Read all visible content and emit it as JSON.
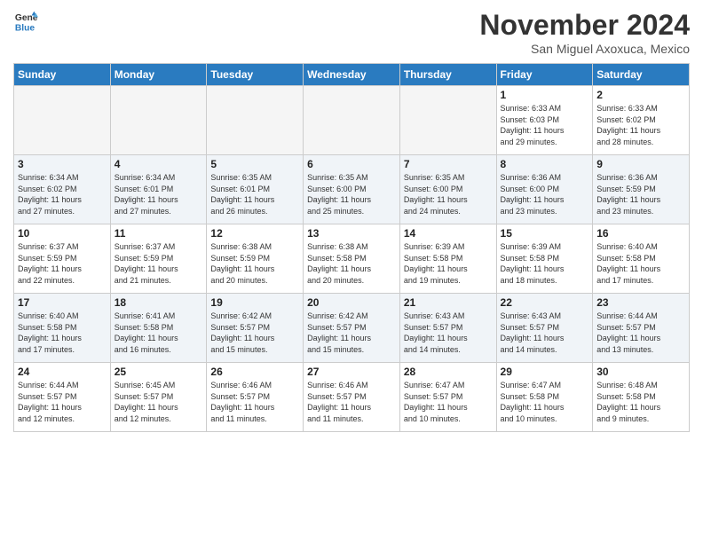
{
  "logo": {
    "line1": "General",
    "line2": "Blue"
  },
  "title": "November 2024",
  "location": "San Miguel Axoxuca, Mexico",
  "days_header": [
    "Sunday",
    "Monday",
    "Tuesday",
    "Wednesday",
    "Thursday",
    "Friday",
    "Saturday"
  ],
  "weeks": [
    [
      {
        "day": "",
        "info": ""
      },
      {
        "day": "",
        "info": ""
      },
      {
        "day": "",
        "info": ""
      },
      {
        "day": "",
        "info": ""
      },
      {
        "day": "",
        "info": ""
      },
      {
        "day": "1",
        "info": "Sunrise: 6:33 AM\nSunset: 6:03 PM\nDaylight: 11 hours\nand 29 minutes."
      },
      {
        "day": "2",
        "info": "Sunrise: 6:33 AM\nSunset: 6:02 PM\nDaylight: 11 hours\nand 28 minutes."
      }
    ],
    [
      {
        "day": "3",
        "info": "Sunrise: 6:34 AM\nSunset: 6:02 PM\nDaylight: 11 hours\nand 27 minutes."
      },
      {
        "day": "4",
        "info": "Sunrise: 6:34 AM\nSunset: 6:01 PM\nDaylight: 11 hours\nand 27 minutes."
      },
      {
        "day": "5",
        "info": "Sunrise: 6:35 AM\nSunset: 6:01 PM\nDaylight: 11 hours\nand 26 minutes."
      },
      {
        "day": "6",
        "info": "Sunrise: 6:35 AM\nSunset: 6:00 PM\nDaylight: 11 hours\nand 25 minutes."
      },
      {
        "day": "7",
        "info": "Sunrise: 6:35 AM\nSunset: 6:00 PM\nDaylight: 11 hours\nand 24 minutes."
      },
      {
        "day": "8",
        "info": "Sunrise: 6:36 AM\nSunset: 6:00 PM\nDaylight: 11 hours\nand 23 minutes."
      },
      {
        "day": "9",
        "info": "Sunrise: 6:36 AM\nSunset: 5:59 PM\nDaylight: 11 hours\nand 23 minutes."
      }
    ],
    [
      {
        "day": "10",
        "info": "Sunrise: 6:37 AM\nSunset: 5:59 PM\nDaylight: 11 hours\nand 22 minutes."
      },
      {
        "day": "11",
        "info": "Sunrise: 6:37 AM\nSunset: 5:59 PM\nDaylight: 11 hours\nand 21 minutes."
      },
      {
        "day": "12",
        "info": "Sunrise: 6:38 AM\nSunset: 5:59 PM\nDaylight: 11 hours\nand 20 minutes."
      },
      {
        "day": "13",
        "info": "Sunrise: 6:38 AM\nSunset: 5:58 PM\nDaylight: 11 hours\nand 20 minutes."
      },
      {
        "day": "14",
        "info": "Sunrise: 6:39 AM\nSunset: 5:58 PM\nDaylight: 11 hours\nand 19 minutes."
      },
      {
        "day": "15",
        "info": "Sunrise: 6:39 AM\nSunset: 5:58 PM\nDaylight: 11 hours\nand 18 minutes."
      },
      {
        "day": "16",
        "info": "Sunrise: 6:40 AM\nSunset: 5:58 PM\nDaylight: 11 hours\nand 17 minutes."
      }
    ],
    [
      {
        "day": "17",
        "info": "Sunrise: 6:40 AM\nSunset: 5:58 PM\nDaylight: 11 hours\nand 17 minutes."
      },
      {
        "day": "18",
        "info": "Sunrise: 6:41 AM\nSunset: 5:58 PM\nDaylight: 11 hours\nand 16 minutes."
      },
      {
        "day": "19",
        "info": "Sunrise: 6:42 AM\nSunset: 5:57 PM\nDaylight: 11 hours\nand 15 minutes."
      },
      {
        "day": "20",
        "info": "Sunrise: 6:42 AM\nSunset: 5:57 PM\nDaylight: 11 hours\nand 15 minutes."
      },
      {
        "day": "21",
        "info": "Sunrise: 6:43 AM\nSunset: 5:57 PM\nDaylight: 11 hours\nand 14 minutes."
      },
      {
        "day": "22",
        "info": "Sunrise: 6:43 AM\nSunset: 5:57 PM\nDaylight: 11 hours\nand 14 minutes."
      },
      {
        "day": "23",
        "info": "Sunrise: 6:44 AM\nSunset: 5:57 PM\nDaylight: 11 hours\nand 13 minutes."
      }
    ],
    [
      {
        "day": "24",
        "info": "Sunrise: 6:44 AM\nSunset: 5:57 PM\nDaylight: 11 hours\nand 12 minutes."
      },
      {
        "day": "25",
        "info": "Sunrise: 6:45 AM\nSunset: 5:57 PM\nDaylight: 11 hours\nand 12 minutes."
      },
      {
        "day": "26",
        "info": "Sunrise: 6:46 AM\nSunset: 5:57 PM\nDaylight: 11 hours\nand 11 minutes."
      },
      {
        "day": "27",
        "info": "Sunrise: 6:46 AM\nSunset: 5:57 PM\nDaylight: 11 hours\nand 11 minutes."
      },
      {
        "day": "28",
        "info": "Sunrise: 6:47 AM\nSunset: 5:57 PM\nDaylight: 11 hours\nand 10 minutes."
      },
      {
        "day": "29",
        "info": "Sunrise: 6:47 AM\nSunset: 5:58 PM\nDaylight: 11 hours\nand 10 minutes."
      },
      {
        "day": "30",
        "info": "Sunrise: 6:48 AM\nSunset: 5:58 PM\nDaylight: 11 hours\nand 9 minutes."
      }
    ]
  ]
}
